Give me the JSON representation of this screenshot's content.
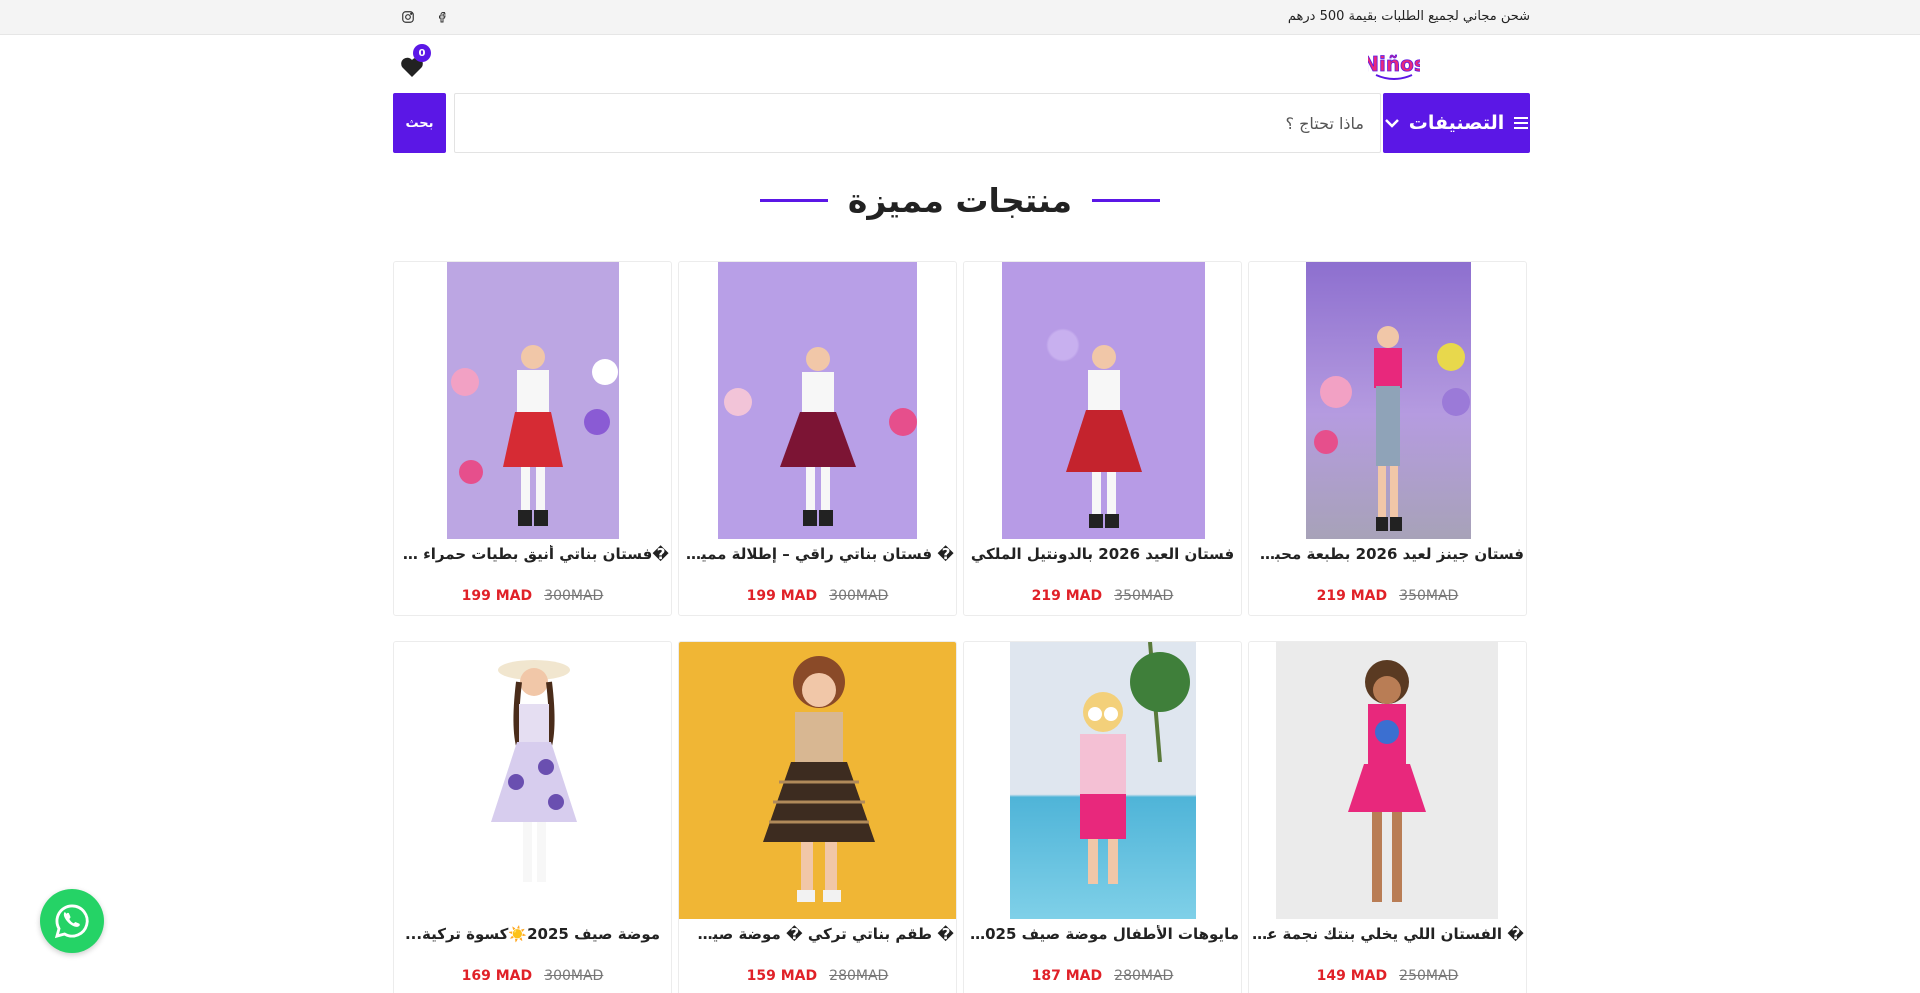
{
  "topbar": {
    "notice": "شحن مجاني لجميع الطلبات بقيمة 500 درهم",
    "social": [
      "instagram-icon",
      "facebook-icon"
    ]
  },
  "header": {
    "logo_text": "Niños",
    "cart_count": "0"
  },
  "search": {
    "button_label": "بحث",
    "placeholder": "ماذا تحتاج ؟",
    "categories_label": "التصنيفات"
  },
  "section": {
    "title": "منتجات مميزة"
  },
  "products": [
    {
      "title": "فستان جينز لعيد 2026 بطبعة محبوبة...",
      "price": "219 MAD",
      "old_price": "350MAD"
    },
    {
      "title": "فستان العيد 2026 بالدونتيل الملكي",
      "price": "219 MAD",
      "old_price": "350MAD"
    },
    {
      "title": "� فستان بناتي راقي – إطلالة مميزة...",
      "price": "199 MAD",
      "old_price": "300MAD"
    },
    {
      "title": "�فستان بناتي أنيق بطيات حمراء موض...",
      "price": "199 MAD",
      "old_price": "300MAD"
    },
    {
      "title": "� الفستان اللي يخلي بنتك نجمة على...",
      "price": "149 MAD",
      "old_price": "250MAD"
    },
    {
      "title": "مايوهات الأطفال موضة صيف 2025 �",
      "price": "187 MAD",
      "old_price": "280MAD"
    },
    {
      "title": "� طقم بناتي تركي � موضة صيف 2025 ��",
      "price": "159 MAD",
      "old_price": "280MAD"
    },
    {
      "title": "موضة صيف 2025☀️كسوة تركية...",
      "price": "169 MAD",
      "old_price": "300MAD"
    }
  ],
  "colors": {
    "accent": "#5b17e6",
    "price": "#e02128",
    "whatsapp": "#25d366"
  }
}
